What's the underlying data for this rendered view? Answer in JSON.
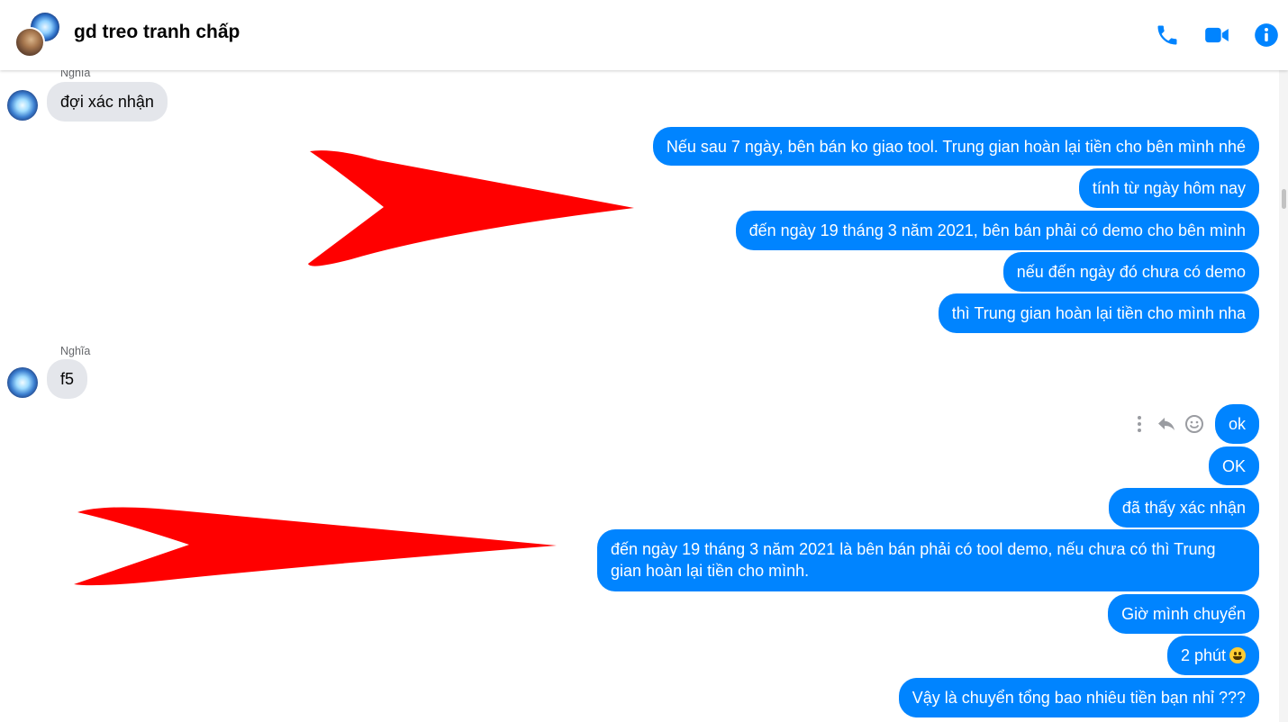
{
  "header": {
    "title": "gd treo tranh chấp",
    "icons": [
      "phone-icon",
      "video-camera-icon",
      "info-icon"
    ],
    "accent_color": "#0084ff"
  },
  "messages": [
    {
      "side": "in",
      "sender": "Nghĩa",
      "text": "đợi xác nhận"
    },
    {
      "side": "out",
      "text": "Nếu sau 7 ngày, bên bán ko giao tool. Trung gian hoàn lại tiền cho bên mình nhé"
    },
    {
      "side": "out",
      "text": "tính từ ngày hôm nay"
    },
    {
      "side": "out",
      "text": "đến ngày 19 tháng 3 năm 2021, bên bán phải có demo cho bên mình"
    },
    {
      "side": "out",
      "text": "nếu đến ngày đó chưa có demo"
    },
    {
      "side": "out",
      "text": "thì Trung gian hoàn lại tiền cho mình nha"
    },
    {
      "side": "in",
      "sender": "Nghĩa",
      "text": "f5"
    },
    {
      "side": "out",
      "text": "ok"
    },
    {
      "side": "out",
      "text": "OK"
    },
    {
      "side": "out",
      "text": "đã thấy xác nhận"
    },
    {
      "side": "out",
      "text": "đến ngày 19 tháng 3 năm 2021 là bên bán phải có tool demo, nếu chưa có thì Trung gian hoàn lại tiền cho mình."
    },
    {
      "side": "out",
      "text": "Giờ mình chuyển"
    },
    {
      "side": "out",
      "text": "2 phút",
      "emoji": "smiling-face-emoji"
    },
    {
      "side": "out",
      "text": "Vậy là chuyển tổng bao nhiêu tiền bạn nhỉ ???"
    }
  ],
  "message_actions": [
    "more-options-icon",
    "reply-icon",
    "react-emoji-icon"
  ],
  "annotation_color": "#ff0000"
}
